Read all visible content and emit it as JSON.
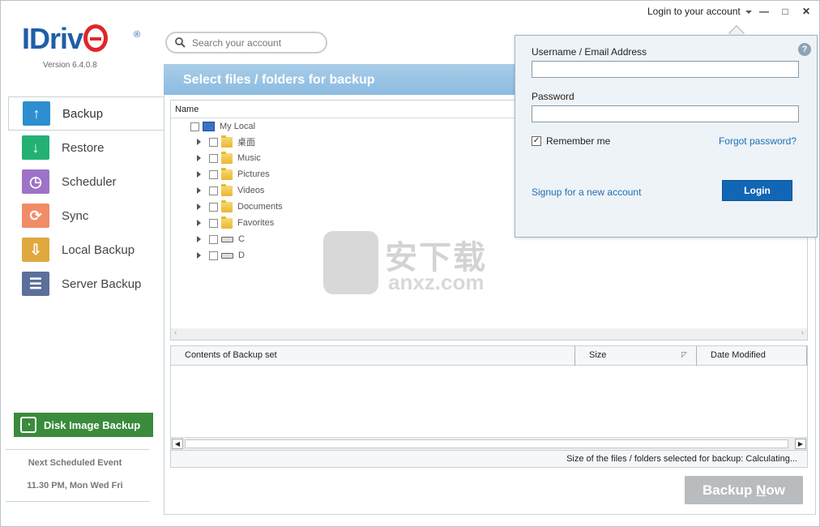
{
  "window": {
    "login_link": "Login to your account",
    "controls": {
      "minimize": "—",
      "maximize": "□",
      "close": "✕"
    }
  },
  "logo": {
    "brand": "IDriv",
    "registered": "®",
    "version": "Version  6.4.0.8"
  },
  "search": {
    "placeholder": "Search your account"
  },
  "sidebar": {
    "items": [
      {
        "label": "Backup",
        "icon": "upload-arrow-icon",
        "color": "#2d8fcf",
        "glyph": "↑"
      },
      {
        "label": "Restore",
        "icon": "download-arrow-icon",
        "color": "#23b073",
        "glyph": "↓"
      },
      {
        "label": "Scheduler",
        "icon": "clock-icon",
        "color": "#9e73c7",
        "glyph": "◷"
      },
      {
        "label": "Sync",
        "icon": "sync-icon",
        "color": "#f08c66",
        "glyph": "⟳"
      },
      {
        "label": "Local Backup",
        "icon": "local-backup-icon",
        "color": "#e0a93f",
        "glyph": "⇩"
      },
      {
        "label": "Server Backup",
        "icon": "server-icon",
        "color": "#5c6f9a",
        "glyph": "☰"
      }
    ],
    "disk_image_button": "Disk Image Backup",
    "next_event_label": "Next Scheduled Event",
    "next_event_time": "11.30 PM, Mon Wed Fri"
  },
  "main": {
    "banner_title": "Select files / folders for backup",
    "tree_header": "Name",
    "tree": {
      "root": "My Local",
      "children": [
        {
          "label": "桌面",
          "type": "folder"
        },
        {
          "label": "Music",
          "type": "folder"
        },
        {
          "label": "Pictures",
          "type": "folder"
        },
        {
          "label": "Videos",
          "type": "folder"
        },
        {
          "label": "Documents",
          "type": "folder"
        },
        {
          "label": "Favorites",
          "type": "folder"
        },
        {
          "label": "C",
          "type": "drive"
        },
        {
          "label": "D",
          "type": "drive"
        }
      ]
    },
    "contents_columns": [
      "Contents of Backup set",
      "Size",
      "Date Modified"
    ],
    "status_text": "Size of the files / folders selected for backup: Calculating...",
    "backup_now": {
      "before": "Backup ",
      "underlined": "N",
      "after": "ow"
    }
  },
  "watermark": {
    "cn": "安下载",
    "en": "anxz.com"
  },
  "login_popup": {
    "username_label": "Username / Email Address",
    "username_value": "",
    "password_label": "Password",
    "password_value": "",
    "remember_label": "Remember me",
    "remember_checked": true,
    "forgot_link": "Forgot password?",
    "signup_link": "Signup for a new account",
    "login_button": "Login",
    "help": "?"
  }
}
